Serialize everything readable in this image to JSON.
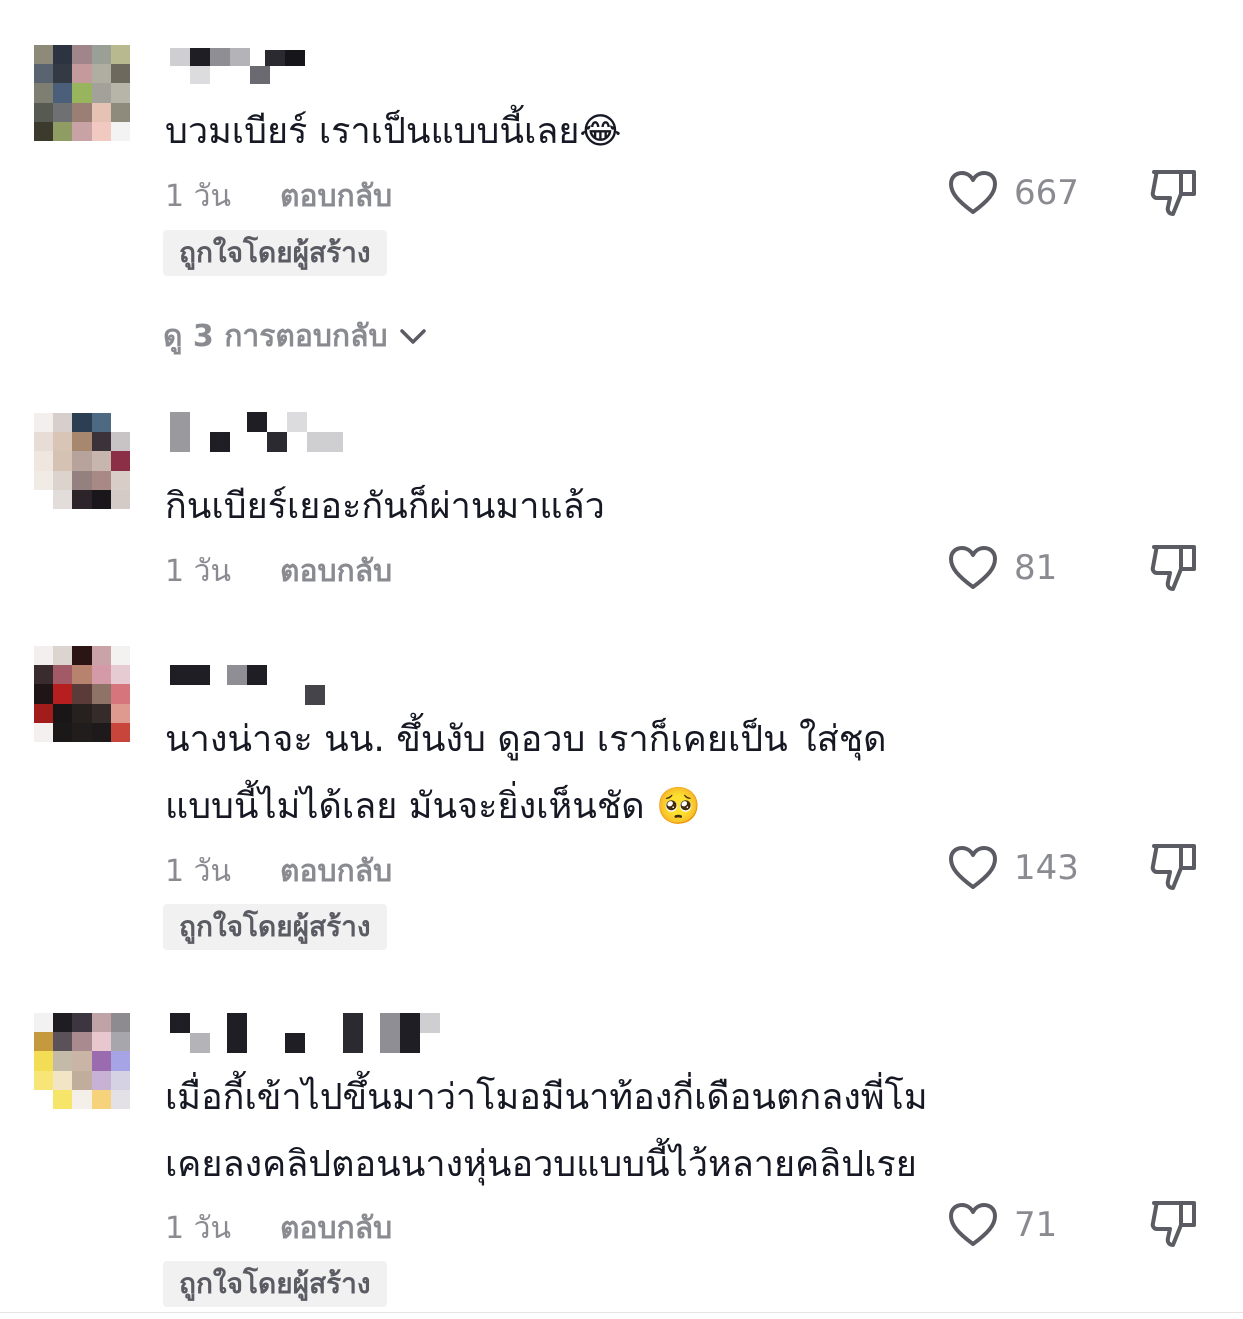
{
  "comments": [
    {
      "text_lines": [
        "บวมเบียร์ เราเป็นแบบนี้เลย😂"
      ],
      "time": "1 วัน",
      "reply_label": "ตอบกลับ",
      "likes": "667",
      "creator_badge": "ถูกใจโดยผู้สร้าง",
      "view_replies": "ดู 3 การตอบกลับ"
    },
    {
      "text_lines": [
        "กินเบียร์เยอะกันก็ผ่านมาแล้ว"
      ],
      "time": "1 วัน",
      "reply_label": "ตอบกลับ",
      "likes": "81"
    },
    {
      "text_lines": [
        "นางน่าจะ นน. ขึ้นงับ ดูอวบ เราก็เคยเป็น ใส่ชุด",
        "แบบนี้ไม่ได้เลย มันจะยิ่งเห็นชัด 🥺"
      ],
      "time": "1 วัน",
      "reply_label": "ตอบกลับ",
      "likes": "143",
      "creator_badge": "ถูกใจโดยผู้สร้าง"
    },
    {
      "text_lines": [
        "เมื่อกี้เข้าไปขึ้นมาว่าโมอมีนาท้องกี่เดือนตกลงพี่โม",
        "เคยลงคลิปตอนนางหุ่นอวบแบบนี้ไว้หลายคลิปเรย"
      ],
      "time": "1 วัน",
      "reply_label": "ตอบกลับ",
      "likes": "71",
      "creator_badge": "ถูกใจโดยผู้สร้าง"
    }
  ],
  "icons": {
    "like": "heart-outline-icon",
    "dislike": "thumbs-down-outline-icon",
    "expand": "chevron-down-icon"
  },
  "colors": {
    "text": "#161823",
    "secondary": "#8a8b91",
    "badge_bg": "#f1f1f2"
  }
}
